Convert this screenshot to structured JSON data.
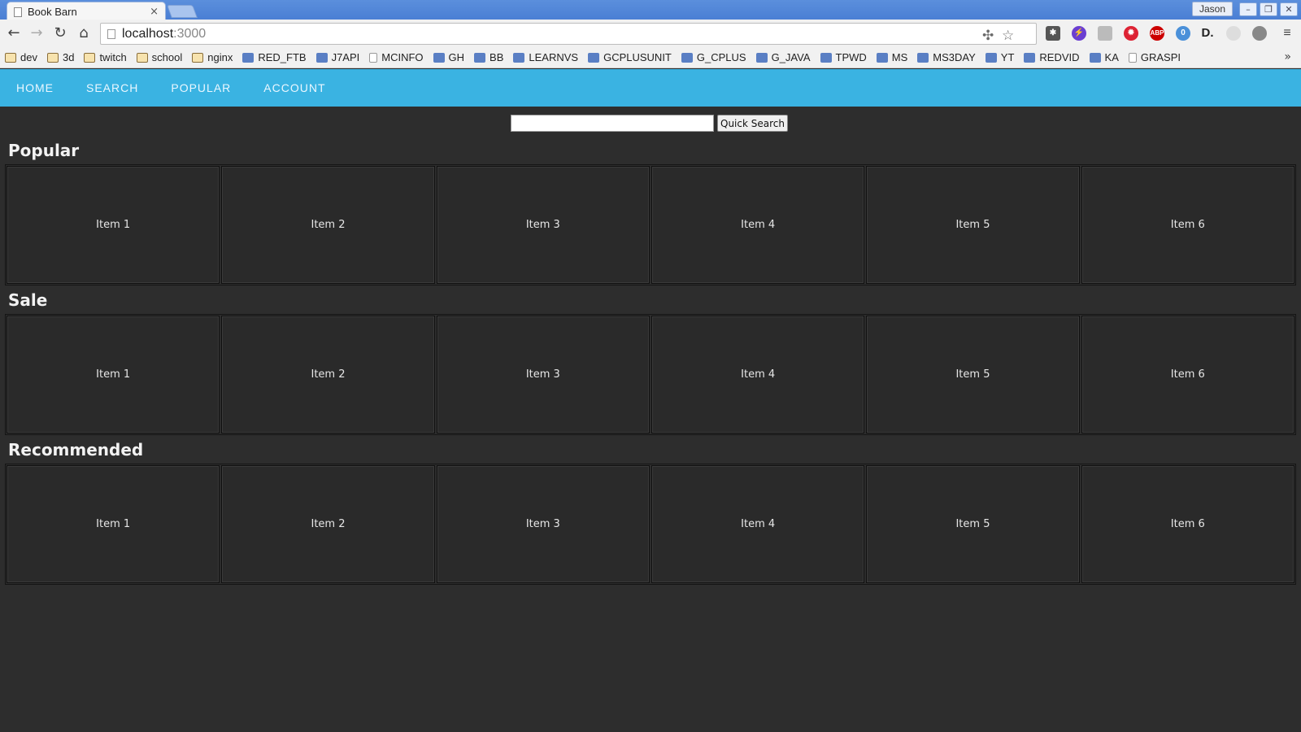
{
  "browser": {
    "tab_title": "Book Barn",
    "tab_close": "×",
    "user": "Jason",
    "window_controls": [
      "–",
      "❐",
      "✕"
    ],
    "url_host": "localhost",
    "url_port": ":3000",
    "more_bookmarks": "»"
  },
  "bookmarks": [
    {
      "label": "dev",
      "kind": "folder"
    },
    {
      "label": "3d",
      "kind": "folder"
    },
    {
      "label": "twitch",
      "kind": "folder"
    },
    {
      "label": "school",
      "kind": "folder"
    },
    {
      "label": "nginx",
      "kind": "folder"
    },
    {
      "label": "RED_FTB",
      "kind": "site"
    },
    {
      "label": "J7API",
      "kind": "site"
    },
    {
      "label": "MCINFO",
      "kind": "file"
    },
    {
      "label": "GH",
      "kind": "site"
    },
    {
      "label": "BB",
      "kind": "site"
    },
    {
      "label": "LEARNVS",
      "kind": "site"
    },
    {
      "label": "GCPLUSUNIT",
      "kind": "site"
    },
    {
      "label": "G_CPLUS",
      "kind": "site"
    },
    {
      "label": "G_JAVA",
      "kind": "site"
    },
    {
      "label": "TPWD",
      "kind": "site"
    },
    {
      "label": "MS",
      "kind": "site"
    },
    {
      "label": "MS3DAY",
      "kind": "site"
    },
    {
      "label": "YT",
      "kind": "site"
    },
    {
      "label": "REDVID",
      "kind": "site"
    },
    {
      "label": "KA",
      "kind": "site"
    },
    {
      "label": "GRASPI",
      "kind": "file"
    }
  ],
  "nav": {
    "home": "HOME",
    "search": "SEARCH",
    "popular": "POPULAR",
    "account": "ACCOUNT"
  },
  "search": {
    "value": "",
    "button": "Quick Search"
  },
  "sections": [
    {
      "title": "Popular",
      "items": [
        "Item 1",
        "Item 2",
        "Item 3",
        "Item 4",
        "Item 5",
        "Item 6"
      ]
    },
    {
      "title": "Sale",
      "items": [
        "Item 1",
        "Item 2",
        "Item 3",
        "Item 4",
        "Item 5",
        "Item 6"
      ]
    },
    {
      "title": "Recommended",
      "items": [
        "Item 1",
        "Item 2",
        "Item 3",
        "Item 4",
        "Item 5",
        "Item 6"
      ]
    }
  ],
  "colors": {
    "nav_bar": "#3ab3e2",
    "page_bg": "#2d2d2d"
  }
}
